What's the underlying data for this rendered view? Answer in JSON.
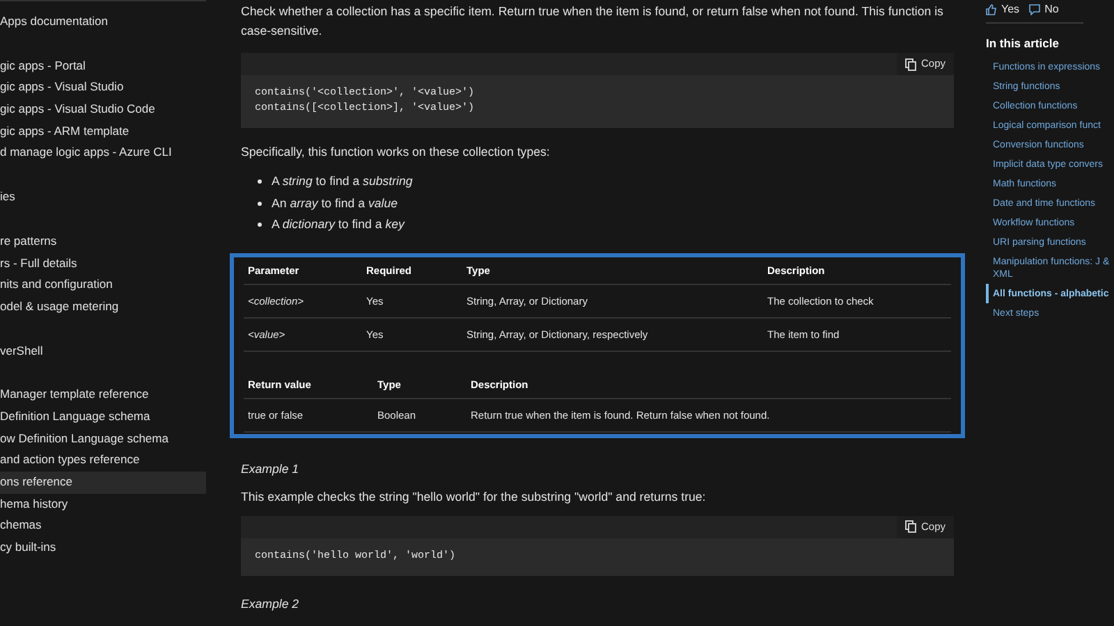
{
  "sidebar": {
    "groups": [
      [
        {
          "label": "Apps documentation",
          "selected": false
        }
      ],
      [
        {
          "label": "gic apps - Portal",
          "selected": false
        },
        {
          "label": "gic apps - Visual Studio",
          "selected": false
        },
        {
          "label": "gic apps - Visual Studio Code",
          "selected": false
        },
        {
          "label": "gic apps - ARM template",
          "selected": false
        },
        {
          "label": "d manage logic apps - Azure CLI",
          "selected": false
        }
      ],
      [
        {
          "label": "ies",
          "selected": false
        }
      ],
      [
        {
          "label": "re patterns",
          "selected": false
        },
        {
          "label": "rs - Full details",
          "selected": false
        },
        {
          "label": "nits and configuration",
          "selected": false
        },
        {
          "label": "odel & usage metering",
          "selected": false
        }
      ],
      [
        {
          "label": "verShell",
          "selected": false
        }
      ],
      [
        {
          "label": "Manager template reference",
          "selected": false
        },
        {
          "label": "Definition Language schema",
          "selected": false
        },
        {
          "label": "ow Definition Language schema",
          "selected": false
        },
        {
          "label": "and action types reference",
          "selected": false
        },
        {
          "label": "ons reference",
          "selected": true
        },
        {
          "label": "hema history",
          "selected": false
        },
        {
          "label": "chemas",
          "selected": false
        },
        {
          "label": "cy built-ins",
          "selected": false
        }
      ]
    ]
  },
  "content": [
    {
      "kind": "paragraph",
      "text": "Check whether a collection has a specific item. Return true when the item is found, or return false when not found. This function is case-sensitive."
    },
    {
      "kind": "code",
      "copy": "Copy",
      "lines": [
        "contains('<collection>', '<value>')",
        "contains([<collection>], '<value>')"
      ]
    },
    {
      "kind": "paragraph",
      "text": "Specifically, this function works on these collection types:"
    },
    {
      "kind": "bullets",
      "items": [
        "A *string* to find a *substring*",
        "An *array* to find a *value*",
        "A *dictionary* to find a *key*"
      ]
    },
    {
      "kind": "tables",
      "highlighted": true,
      "tables": [
        {
          "columns": [
            "Parameter",
            "Required",
            "Type",
            "Description"
          ],
          "rows": [
            [
              "<collection>",
              "Yes",
              "String, Array, or Dictionary",
              "The collection to check"
            ],
            [
              "<value>",
              "Yes",
              "String, Array, or Dictionary, respectively",
              "The item to find"
            ]
          ]
        },
        {
          "columns": [
            "Return value",
            "Type",
            "Description"
          ],
          "rows": [
            [
              "true or false",
              "Boolean",
              "Return true when the item is found. Return false when not found."
            ]
          ]
        }
      ]
    },
    {
      "kind": "heading",
      "text": "Example 1"
    },
    {
      "kind": "paragraph",
      "text": "This example checks the string \"hello world\" for the substring \"world\" and returns true:"
    },
    {
      "kind": "code",
      "copy": "Copy",
      "lines": [
        "contains('hello world', 'world')"
      ]
    },
    {
      "kind": "heading",
      "text": "Example 2"
    }
  ],
  "feedback": {
    "yes": "Yes",
    "no": "No"
  },
  "toc": {
    "title": "In this article",
    "items": [
      {
        "label": "Functions in expressions",
        "selected": false
      },
      {
        "label": "String functions",
        "selected": false
      },
      {
        "label": "Collection functions",
        "selected": false
      },
      {
        "label": "Logical comparison funct",
        "selected": false
      },
      {
        "label": "Conversion functions",
        "selected": false
      },
      {
        "label": "Implicit data type convers",
        "selected": false
      },
      {
        "label": "Math functions",
        "selected": false
      },
      {
        "label": "Date and time functions",
        "selected": false
      },
      {
        "label": "Workflow functions",
        "selected": false
      },
      {
        "label": "URI parsing functions",
        "selected": false
      },
      {
        "label": "Manipulation functions: J & XML",
        "selected": false
      },
      {
        "label": "All functions - alphabetic",
        "selected": true
      },
      {
        "label": "Next steps",
        "selected": false
      }
    ]
  }
}
